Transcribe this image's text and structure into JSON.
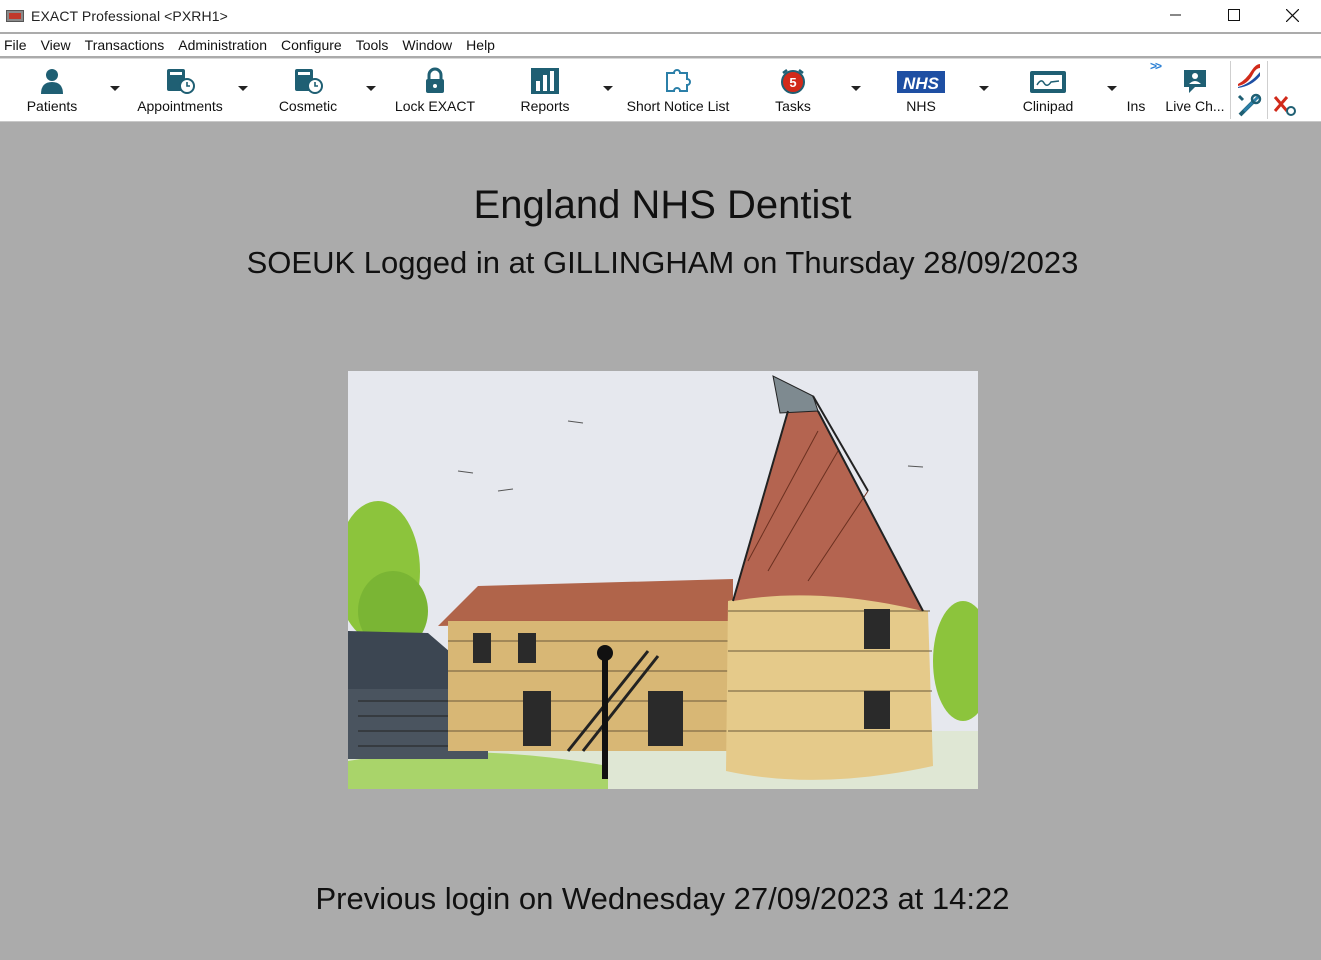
{
  "window": {
    "title": "EXACT Professional <PXRH1>"
  },
  "menu": [
    "File",
    "View",
    "Transactions",
    "Administration",
    "Configure",
    "Tools",
    "Window",
    "Help"
  ],
  "toolbar": {
    "patients": "Patients",
    "appointments": "Appointments",
    "cosmetic": "Cosmetic",
    "lock": "Lock EXACT",
    "reports": "Reports",
    "short_notice": "Short Notice List",
    "tasks": "Tasks",
    "tasks_badge": "5",
    "nhs": "NHS",
    "nhs_logo": "NHS",
    "clinipad": "Clinipad",
    "ins": "Ins",
    "live_chat": "Live Ch..."
  },
  "main": {
    "practice_title": "England NHS Dentist",
    "login_line": "SOEUK Logged in at GILLINGHAM on Thursday 28/09/2023",
    "previous_login": "Previous login on Wednesday 27/09/2023 at 14:22"
  },
  "colors": {
    "accent": "#1f5f73",
    "background": "#ababab",
    "nhs_blue": "#1e4fa3",
    "badge_red": "#d12a1a"
  }
}
